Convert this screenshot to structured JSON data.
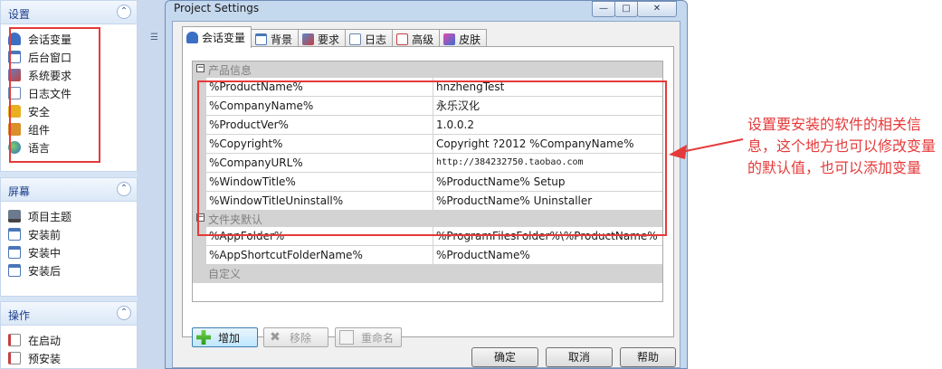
{
  "sidebar": {
    "sections": [
      {
        "title": "设置",
        "items": [
          {
            "label": "会话变量",
            "icon": "variables-icon"
          },
          {
            "label": "后台窗口",
            "icon": "window-icon"
          },
          {
            "label": "系统要求",
            "icon": "requirements-icon"
          },
          {
            "label": "日志文件",
            "icon": "log-file-icon"
          },
          {
            "label": "安全",
            "icon": "lock-icon"
          },
          {
            "label": "组件",
            "icon": "component-icon"
          },
          {
            "label": "语言",
            "icon": "globe-icon"
          }
        ]
      },
      {
        "title": "屏幕",
        "items": [
          {
            "label": "项目主题",
            "icon": "theme-icon"
          },
          {
            "label": "安装前",
            "icon": "screen-icon"
          },
          {
            "label": "安装中",
            "icon": "screen-icon"
          },
          {
            "label": "安装后",
            "icon": "screen-icon"
          }
        ]
      },
      {
        "title": "操作",
        "items": [
          {
            "label": "在启动",
            "icon": "script-icon"
          },
          {
            "label": "预安装",
            "icon": "script-icon"
          }
        ]
      }
    ]
  },
  "dialog": {
    "title": "Project Settings",
    "tabs": [
      {
        "label": "会话变量",
        "active": true
      },
      {
        "label": "背景",
        "active": false
      },
      {
        "label": "要求",
        "active": false
      },
      {
        "label": "日志",
        "active": false
      },
      {
        "label": "高级",
        "active": false
      },
      {
        "label": "皮肤",
        "active": false
      }
    ],
    "grid": {
      "categories": [
        {
          "label": "产品信息",
          "rows": [
            {
              "name": "%ProductName%",
              "value": "hnzhengTest"
            },
            {
              "name": "%CompanyName%",
              "value": "永乐汉化"
            },
            {
              "name": "%ProductVer%",
              "value": "1.0.0.2"
            },
            {
              "name": "%Copyright%",
              "value": "Copyright ?2012 %CompanyName%"
            },
            {
              "name": "%CompanyURL%",
              "value": "http://384232750.taobao.com"
            },
            {
              "name": "%WindowTitle%",
              "value": "%ProductName% Setup"
            },
            {
              "name": "%WindowTitleUninstall%",
              "value": "%ProductName% Uninstaller"
            }
          ]
        },
        {
          "label": "文件夹默认",
          "rows": [
            {
              "name": "%AppFolder%",
              "value": "%ProgramFilesFolder%\\%ProductName%"
            },
            {
              "name": "%AppShortcutFolderName%",
              "value": "%ProductName%"
            }
          ]
        },
        {
          "label": "自定义",
          "rows": []
        }
      ]
    },
    "actions": {
      "add": "增加",
      "remove": "移除",
      "rename": "重命名"
    },
    "buttons": {
      "ok": "确定",
      "cancel": "取消",
      "help": "帮助"
    }
  },
  "annotation": "设置要安装的软件的相关信息，这个地方也可以修改变量的默认值，也可以添加变量",
  "colors": {
    "highlight_red": "#e53a3a",
    "pane_blue": "#d6e4f5",
    "header_text": "#1c3e8c"
  }
}
